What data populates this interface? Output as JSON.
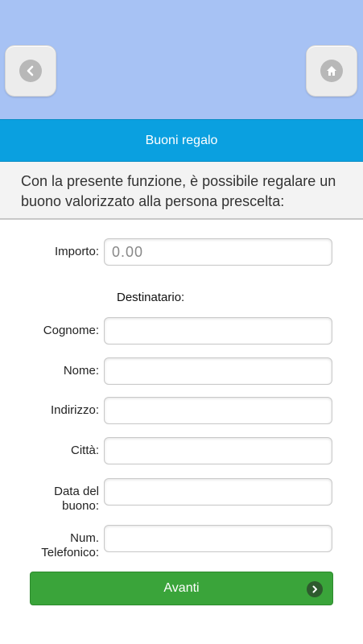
{
  "header": {
    "back_icon": "chevron-left-icon",
    "home_icon": "home-icon",
    "banner_color": "#a7c2f4"
  },
  "title_bar": {
    "title": "Buoni regalo",
    "color": "#0aa0e0"
  },
  "intro": {
    "text": "Con la presente funzione, è possibile regalare un buono valorizzato alla persona prescelta:"
  },
  "form": {
    "amount": {
      "label": "Importo:",
      "placeholder": "0.00"
    },
    "recipient_heading": "Destinatario:",
    "surname": {
      "label": "Cognome:",
      "value": ""
    },
    "name": {
      "label": "Nome:",
      "value": ""
    },
    "address": {
      "label": "Indirizzo:",
      "value": ""
    },
    "city": {
      "label": "Città:",
      "value": ""
    },
    "voucher_date": {
      "label_line1": "Data del",
      "label_line2": "buono:",
      "value": ""
    },
    "phone": {
      "label_line1": "Num.",
      "label_line2": "Telefonico:",
      "value": ""
    }
  },
  "next_button": {
    "label": "Avanti",
    "icon": "chevron-right-icon",
    "color": "#3aa43a"
  }
}
